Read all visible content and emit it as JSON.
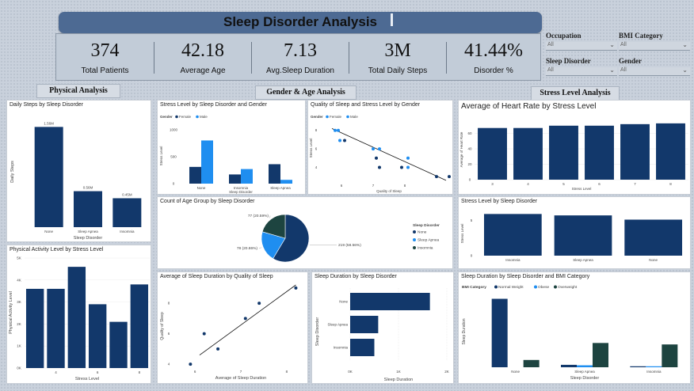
{
  "header": {
    "title": "Sleep Disorder Analysis"
  },
  "kpis": [
    {
      "value": "374",
      "label": "Total Patients"
    },
    {
      "value": "42.18",
      "label": "Average Age"
    },
    {
      "value": "7.13",
      "label": "Avg.Sleep Duration"
    },
    {
      "value": "3M",
      "label": "Total Daily Steps"
    },
    {
      "value": "41.44%",
      "label": "Disorder %"
    }
  ],
  "slicers": [
    {
      "label": "Occupation",
      "value": "All"
    },
    {
      "label": "BMI Category",
      "value": "All"
    },
    {
      "label": "Sleep Disorder",
      "value": "All"
    },
    {
      "label": "Gender",
      "value": "All"
    }
  ],
  "sections": {
    "physical": "Physical Analysis",
    "gender_age": "Gender & Age Analysis",
    "stress": "Stress Level Analysis"
  },
  "colors": {
    "dark_blue": "#12386b",
    "light_blue": "#1f8ef0",
    "dark_green": "#1d4440",
    "header_bg": "#4d6a93"
  },
  "chart_data": [
    {
      "id": "daily_steps",
      "type": "bar",
      "title": "Daily Steps by Sleep Disorder",
      "xlabel": "Sleep Disorder",
      "ylabel": "Daily Steps",
      "categories": [
        "None",
        "Sleep Apnea",
        "Insomnia"
      ],
      "values": [
        1.56,
        0.56,
        0.45
      ],
      "data_labels": [
        "1.56M",
        "0.56M",
        "0.45M"
      ],
      "ylim": [
        0,
        1.7
      ]
    },
    {
      "id": "activity_stress",
      "type": "bar",
      "title": "Physical Activity Level by Stress Level",
      "xlabel": "Stress Level",
      "ylabel": "Physical Activity Level",
      "categories": [
        "3",
        "4",
        "5",
        "6",
        "7",
        "8"
      ],
      "values": [
        3.6,
        3.6,
        4.6,
        2.9,
        2.1,
        3.8
      ],
      "yticks": [
        "0K",
        "1K",
        "2K",
        "3K",
        "4K",
        "5K"
      ],
      "ylim": [
        0,
        5
      ],
      "xticks": [
        "4",
        "6",
        "8"
      ]
    },
    {
      "id": "stress_gender",
      "type": "bar",
      "title": "Stress Level by Sleep Disorder and Gender",
      "xlabel": "Sleep Disorder",
      "ylabel": "Stress Level",
      "legend_title": "Gender",
      "categories": [
        "None",
        "Insomnia",
        "Sleep Apnea"
      ],
      "series": [
        {
          "name": "Female",
          "values": [
            310,
            170,
            360
          ]
        },
        {
          "name": "Male",
          "values": [
            800,
            270,
            70
          ]
        }
      ],
      "yticks": [
        "0",
        "500",
        "1000"
      ],
      "ylim": [
        0,
        1100
      ]
    },
    {
      "id": "quality_stress",
      "type": "scatter",
      "title": "Quality of Sleep and Stress Level by Gender",
      "xlabel": "Quality of Sleep",
      "ylabel": "Stress Level",
      "legend_title": "Gender",
      "legend": [
        "Female",
        "Male"
      ],
      "points": [
        [
          5.8,
          8,
          "F"
        ],
        [
          5.9,
          8,
          "F"
        ],
        [
          5.95,
          6.9,
          "F"
        ],
        [
          6.1,
          6.9,
          "M"
        ],
        [
          7,
          6,
          "F"
        ],
        [
          7.2,
          6,
          "F"
        ],
        [
          7.1,
          5,
          "M"
        ],
        [
          7.2,
          4,
          "M"
        ],
        [
          7.9,
          4,
          "M"
        ],
        [
          8.1,
          5,
          "F"
        ],
        [
          8.1,
          4,
          "F"
        ],
        [
          9,
          3,
          "M"
        ],
        [
          9.4,
          3,
          "M"
        ]
      ],
      "trend": [
        [
          5.7,
          8.2
        ],
        [
          9.3,
          2.6
        ]
      ],
      "xticks": [
        "6",
        "7",
        "8"
      ],
      "yticks": [
        "4",
        "6",
        "8"
      ],
      "xlim": [
        5.5,
        9.5
      ],
      "ylim": [
        2.5,
        9
      ]
    },
    {
      "id": "age_group",
      "type": "pie",
      "title": "Count of Age Group by Sleep Disorder",
      "legend_title": "Sleep Disorder",
      "slices": [
        {
          "name": "None",
          "value": 219,
          "label": "219 (58.56%)"
        },
        {
          "name": "Sleep Apnea",
          "value": 78,
          "label": "78 (20.86%)"
        },
        {
          "name": "Insomnia",
          "value": 77,
          "label": "77 (20.59%)"
        }
      ]
    },
    {
      "id": "sleep_quality_duration",
      "type": "scatter",
      "title": "Average of Sleep Duration by Quality of Sleep",
      "xlabel": "Average of Sleep Duration",
      "ylabel": "Quality of Sleep",
      "points": [
        [
          5.9,
          4
        ],
        [
          6.2,
          6
        ],
        [
          6.5,
          5
        ],
        [
          7.1,
          7
        ],
        [
          7.4,
          8
        ],
        [
          8.2,
          9
        ]
      ],
      "trend": [
        [
          6.1,
          4.6
        ],
        [
          8.2,
          9.2
        ]
      ],
      "xticks": [
        "6",
        "7",
        "8"
      ],
      "yticks": [
        "4",
        "6",
        "8"
      ],
      "xlim": [
        5.6,
        8.4
      ],
      "ylim": [
        3.8,
        9.2
      ]
    },
    {
      "id": "duration_disorder",
      "type": "bar",
      "orientation": "horizontal",
      "title": "Sleep Duration by Sleep Disorder",
      "xlabel": "Sleep Duration",
      "ylabel": "Sleep Disorder",
      "categories": [
        "None",
        "Sleep Apnea",
        "Insomnia"
      ],
      "values": [
        1650,
        580,
        500
      ],
      "xticks": [
        "0K",
        "1K",
        "2K"
      ],
      "xlim": [
        0,
        2000
      ]
    },
    {
      "id": "heart_rate_stress",
      "type": "bar",
      "title": "Average of Heart Rate by Stress Level",
      "xlabel": "Stress Level",
      "ylabel": "Average of Heart Rate",
      "categories": [
        "3",
        "4",
        "5",
        "6",
        "7",
        "8"
      ],
      "values": [
        67,
        67,
        70,
        70,
        72,
        73
      ],
      "yticks": [
        "0",
        "20",
        "40",
        "60"
      ],
      "ylim": [
        0,
        78
      ]
    },
    {
      "id": "stress_disorder",
      "type": "bar",
      "title": "Stress Level by Sleep Disorder",
      "xlabel": "",
      "ylabel": "Stress Level",
      "categories": [
        "Insomnia",
        "Sleep Apnea",
        "None"
      ],
      "values": [
        5.9,
        5.7,
        5.1
      ],
      "yticks": [
        "0",
        "5"
      ],
      "ylim": [
        0,
        6.5
      ]
    },
    {
      "id": "duration_bmi",
      "type": "bar",
      "title": "Sleep Duration by Sleep Disorder and BMI Category",
      "xlabel": "Sleep Disorder",
      "ylabel": "Sleep Duration",
      "legend_title": "BMI Category",
      "categories": [
        "None",
        "Sleep Apnea",
        "Insomnia"
      ],
      "series": [
        {
          "name": "Normal Weight",
          "values": [
            1410,
            50,
            20
          ]
        },
        {
          "name": "Obese",
          "values": [
            0,
            40,
            20
          ]
        },
        {
          "name": "Overweight",
          "values": [
            150,
            500,
            470
          ]
        }
      ],
      "ylim": [
        0,
        1500
      ]
    }
  ]
}
